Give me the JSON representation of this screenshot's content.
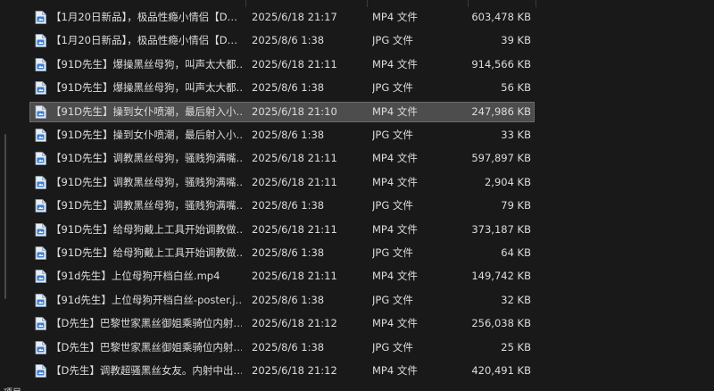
{
  "icons": {
    "file": "document-file-icon"
  },
  "colors": {
    "selected_row": "#4d4d4d",
    "icon_blue": "#3b7fd1"
  },
  "status_bar": {
    "label": "项目"
  },
  "files": [
    {
      "name": "【1月20日新品】，极品性瘾小情侣【D…",
      "date": "2025/6/18 21:17",
      "type": "MP4 文件",
      "size": "603,478 KB"
    },
    {
      "name": "【1月20日新品】，极品性瘾小情侣【D…",
      "date": "2025/8/6 1:38",
      "type": "JPG 文件",
      "size": "39 KB"
    },
    {
      "name": "【91D先生】爆操黑丝母狗，叫声太大都…",
      "date": "2025/6/18 21:11",
      "type": "MP4 文件",
      "size": "914,566 KB"
    },
    {
      "name": "【91D先生】爆操黑丝母狗，叫声太大都…",
      "date": "2025/8/6 1:38",
      "type": "JPG 文件",
      "size": "56 KB"
    },
    {
      "name": "【91D先生】操到女仆喷潮，最后射入小…",
      "date": "2025/6/18 21:10",
      "type": "MP4 文件",
      "size": "247,986 KB",
      "selected": true
    },
    {
      "name": "【91D先生】操到女仆喷潮，最后射入小…",
      "date": "2025/8/6 1:38",
      "type": "JPG 文件",
      "size": "33 KB"
    },
    {
      "name": "【91D先生】调教黑丝母狗，骚贱狗满嘴…",
      "date": "2025/6/18 21:11",
      "type": "MP4 文件",
      "size": "597,897 KB"
    },
    {
      "name": "【91D先生】调教黑丝母狗，骚贱狗满嘴…",
      "date": "2025/6/18 21:11",
      "type": "MP4 文件",
      "size": "2,904 KB"
    },
    {
      "name": "【91D先生】调教黑丝母狗，骚贱狗满嘴…",
      "date": "2025/8/6 1:38",
      "type": "JPG 文件",
      "size": "79 KB"
    },
    {
      "name": "【91D先生】给母狗戴上工具开始调教做…",
      "date": "2025/6/18 21:11",
      "type": "MP4 文件",
      "size": "373,187 KB"
    },
    {
      "name": "【91D先生】给母狗戴上工具开始调教做…",
      "date": "2025/8/6 1:38",
      "type": "JPG 文件",
      "size": "64 KB"
    },
    {
      "name": "【91d先生】上位母狗开档白丝.mp4",
      "date": "2025/6/18 21:11",
      "type": "MP4 文件",
      "size": "149,742 KB"
    },
    {
      "name": "【91d先生】上位母狗开档白丝-poster.j…",
      "date": "2025/8/6 1:38",
      "type": "JPG 文件",
      "size": "32 KB"
    },
    {
      "name": "【D先生】巴黎世家黑丝御姐乘骑位内射…",
      "date": "2025/6/18 21:12",
      "type": "MP4 文件",
      "size": "256,038 KB"
    },
    {
      "name": "【D先生】巴黎世家黑丝御姐乘骑位内射…",
      "date": "2025/8/6 1:38",
      "type": "JPG 文件",
      "size": "25 KB"
    },
    {
      "name": "【D先生】调教超骚黑丝女友。内射中出…",
      "date": "2025/6/18 21:12",
      "type": "MP4 文件",
      "size": "420,491 KB"
    }
  ]
}
